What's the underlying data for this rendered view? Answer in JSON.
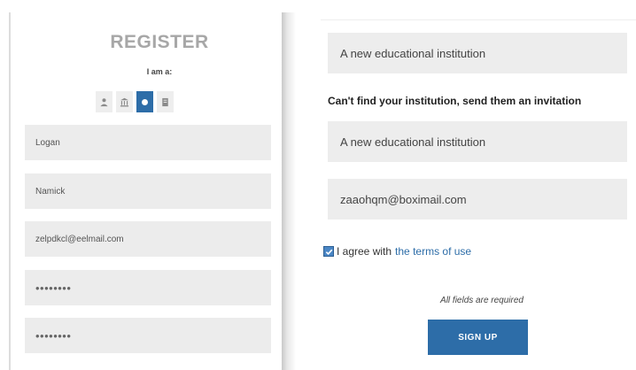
{
  "register": {
    "title": "REGISTER",
    "iam_label": "I am a:",
    "roles": [
      {
        "icon": "person-icon",
        "active": false
      },
      {
        "icon": "institution-icon",
        "active": false
      },
      {
        "icon": "circle-icon",
        "active": true
      },
      {
        "icon": "book-icon",
        "active": false
      }
    ],
    "first_name": "Logan",
    "last_name": "Namick",
    "email": "zelpdkcl@eelmail.com",
    "password": "••••••••",
    "password_confirm": "••••••••"
  },
  "institution": {
    "selected": "A new educational institution",
    "invite_prompt": "Can't find your institution, send them an invitation",
    "invite_name": "A new educational institution",
    "invite_email": "zaaohqm@boximail.com"
  },
  "terms": {
    "agree_text": "I agree with",
    "link_text": "the terms of use",
    "checked": true
  },
  "footer": {
    "required_note": "All fields are required",
    "signup_label": "SIGN UP"
  },
  "colors": {
    "accent": "#2d6da8",
    "field_bg": "#ececec",
    "title_gray": "#a7a7a7"
  }
}
